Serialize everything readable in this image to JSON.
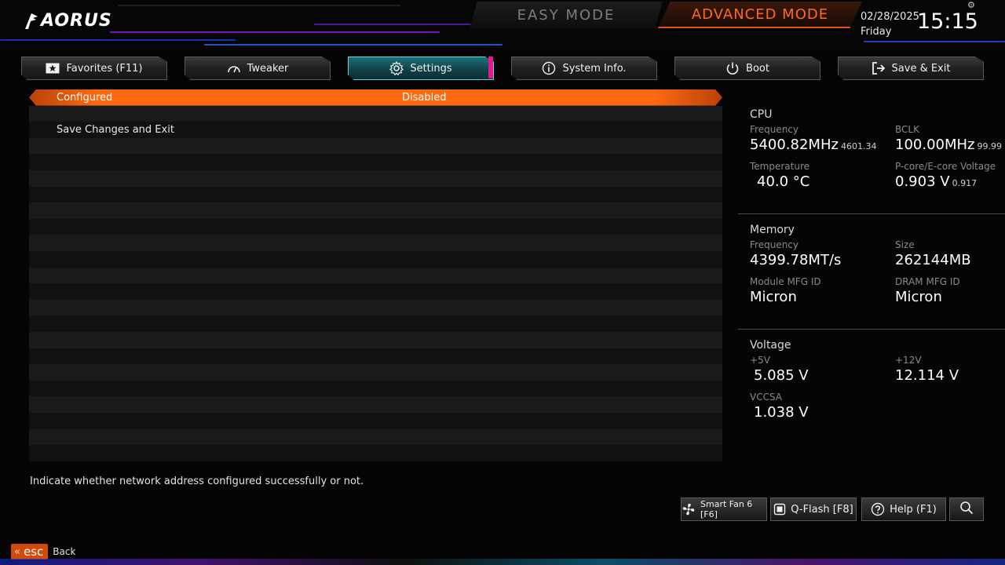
{
  "header": {
    "brand": "AORUS",
    "easy_mode": "EASY MODE",
    "advanced_mode": "ADVANCED MODE",
    "date": "02/28/2025",
    "day": "Friday",
    "time": "15:15"
  },
  "tabs": [
    {
      "label": "Favorites (F11)",
      "icon": "star-icon"
    },
    {
      "label": "Tweaker",
      "icon": "speedometer-icon"
    },
    {
      "label": "Settings",
      "icon": "gear-icon",
      "active": true
    },
    {
      "label": "System Info.",
      "icon": "info-icon"
    },
    {
      "label": "Boot",
      "icon": "power-icon"
    },
    {
      "label": "Save & Exit",
      "icon": "exit-icon"
    }
  ],
  "settings": {
    "rows": [
      {
        "label": "Configured",
        "value": "Disabled",
        "selected": true
      },
      {
        "label": "",
        "value": ""
      },
      {
        "label": "Save Changes and Exit",
        "value": ""
      }
    ]
  },
  "panel": {
    "cpu": {
      "title": "CPU",
      "frequency_label": "Frequency",
      "frequency": "5400.82MHz",
      "frequency_sub": "4601.34",
      "bclk_label": "BCLK",
      "bclk": "100.00MHz",
      "bclk_sub": "99.99",
      "temperature_label": "Temperature",
      "temperature": "40.0 °C",
      "voltage_label": "P-core/E-core Voltage",
      "voltage": "0.903 V",
      "voltage_sub": "0.917"
    },
    "memory": {
      "title": "Memory",
      "frequency_label": "Frequency",
      "frequency": "4399.78MT/s",
      "size_label": "Size",
      "size": "262144MB",
      "module_label": "Module MFG ID",
      "module": "Micron",
      "dram_label": "DRAM MFG ID",
      "dram": "Micron"
    },
    "voltage": {
      "title": "Voltage",
      "v5_label": "+5V",
      "v5": "5.085 V",
      "v12_label": "+12V",
      "v12": "12.114 V",
      "vccsa_label": "VCCSA",
      "vccsa": "1.038 V"
    }
  },
  "help_text": "Indicate whether network address configured successfully or not.",
  "bottom_buttons": {
    "smart_fan": "Smart Fan 6 [F6]",
    "qflash": "Q-Flash [F8]",
    "help": "Help (F1)"
  },
  "footer": {
    "esc": "esc",
    "back": "Back"
  },
  "colors": {
    "accent_orange": "#ff6a10",
    "active_tab_cyan": "#5ad6e0",
    "active_tab_pink": "#e0198f"
  }
}
